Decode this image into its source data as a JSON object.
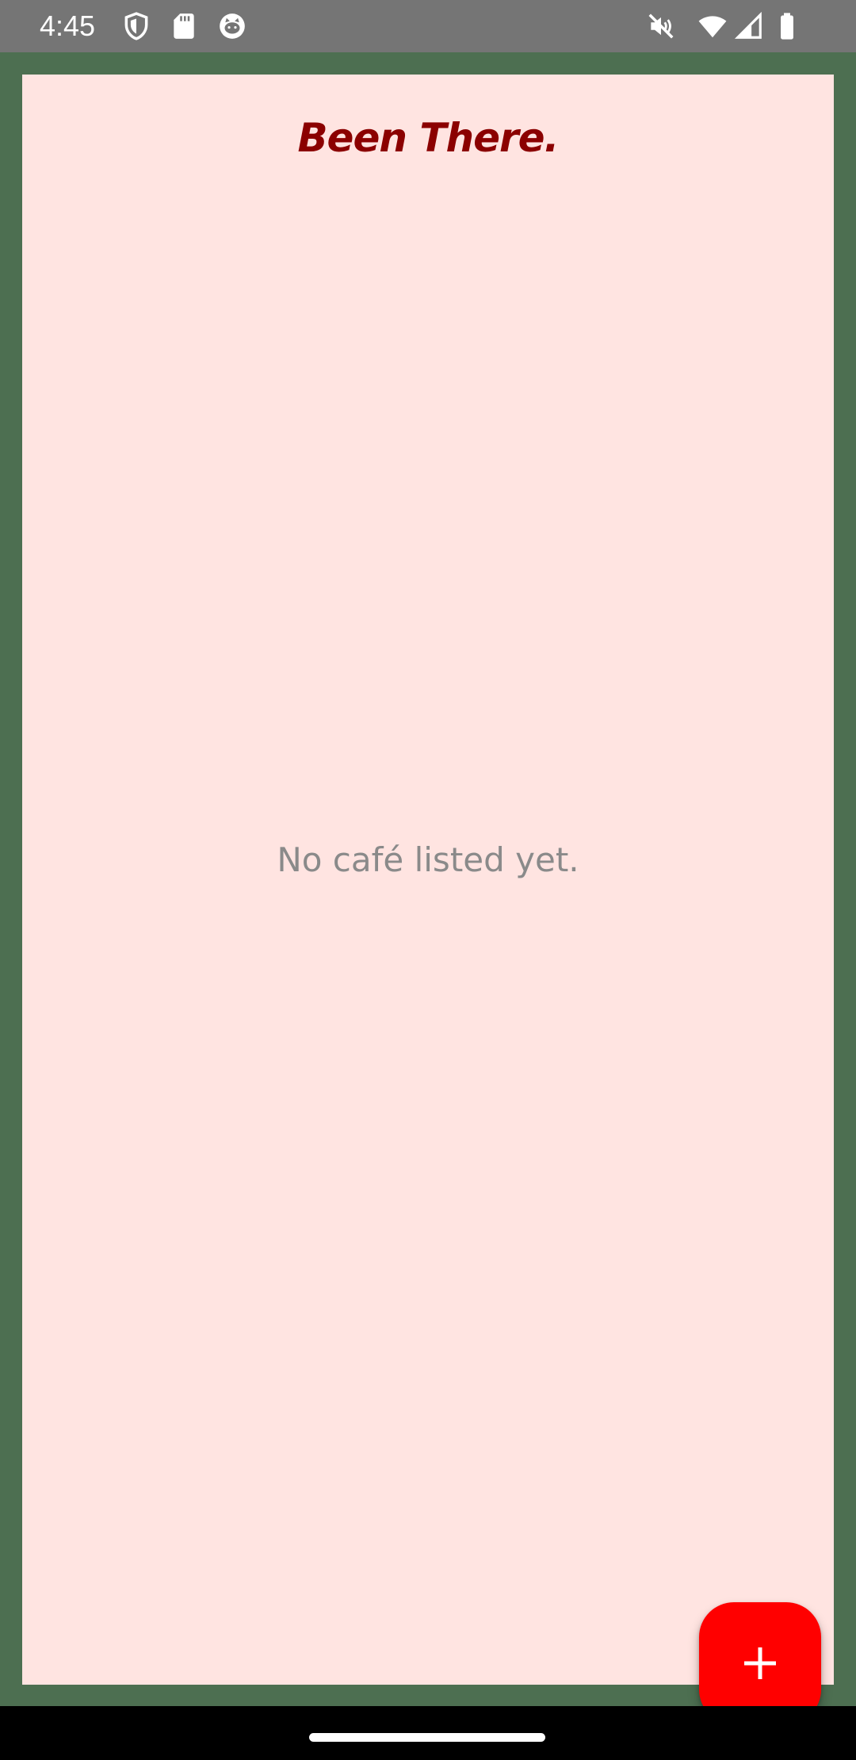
{
  "status_bar": {
    "time": "4:45",
    "left_icons": [
      "shield-icon",
      "sd-card-icon",
      "cat-face-icon"
    ],
    "right_icons": [
      "muted-vibrate-icon",
      "wifi-icon",
      "cellular-signal-icon",
      "battery-icon"
    ]
  },
  "app": {
    "title": "Been There.",
    "empty_message": "No café listed yet.",
    "fab_icon": "plus-icon"
  },
  "colors": {
    "frame": "#4d6f51",
    "content_background": "#ffe4e1",
    "title": "#8b0000",
    "fab": "#ff0000",
    "status_bar": "#757575",
    "nav_bar": "#000000"
  }
}
